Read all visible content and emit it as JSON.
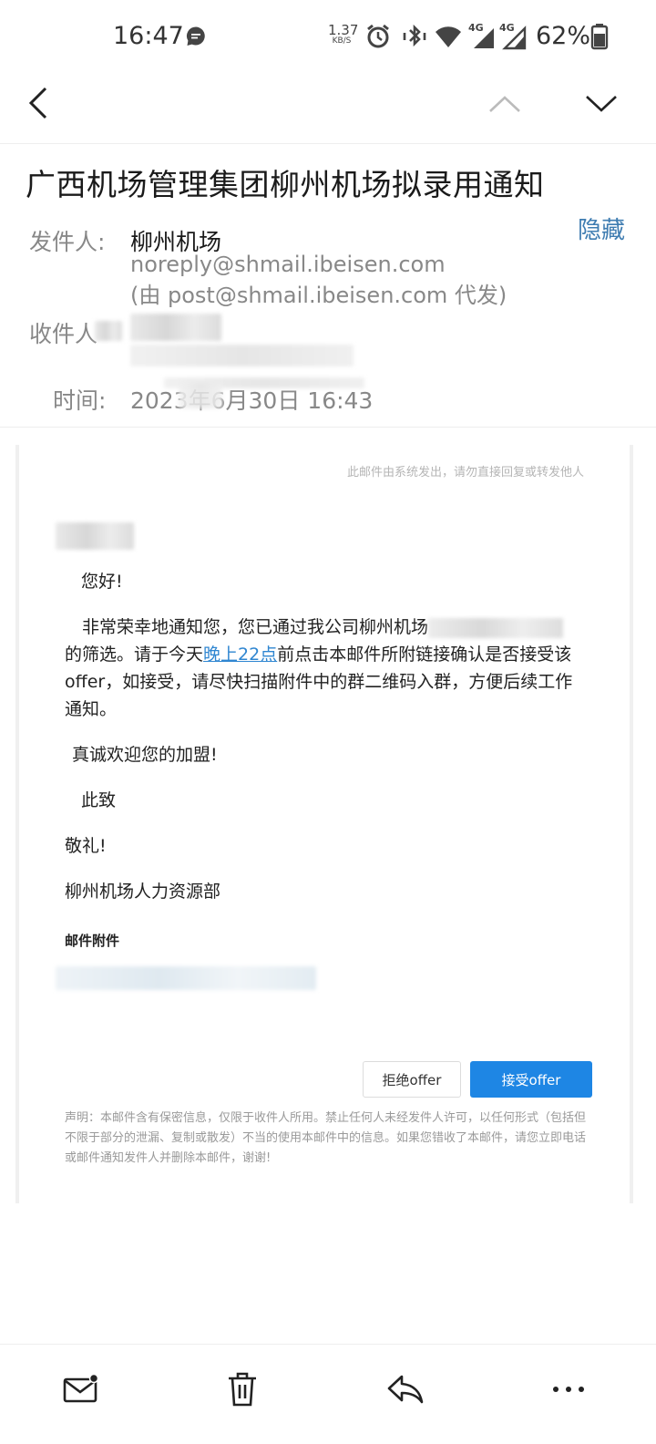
{
  "status_bar": {
    "time": "16:47",
    "net_speed": "1.37",
    "net_unit": "KB/S",
    "signal_1": "4G",
    "signal_2": "4G",
    "battery": "62%"
  },
  "subject": "广西机场管理集团柳州机场拟录用通知",
  "header": {
    "from_label": "发件人:",
    "from_name": "柳州机场",
    "from_email": "noreply@shmail.ibeisen.com",
    "from_via": "(由 post@shmail.ibeisen.com 代发)",
    "to_label": "收件人",
    "time_label": "时间:",
    "time_value": "2023年6月30日 16:43",
    "hide_label": "隐藏"
  },
  "mail": {
    "notice": "此邮件由系统发出，请勿直接回复或转发他人",
    "greeting": "您好!",
    "para_before": "非常荣幸地通知您，您已通过我公司柳州机场",
    "para_mid": "的筛选。请于今天",
    "link_text": "晚上22点",
    "para_after": "前点击本邮件所附链接确认是否接受该offer，如接受，请尽快扫描附件中的群二维码入群，方便后续工作通知。",
    "welcome": "真诚欢迎您的加盟!",
    "closing": "此致",
    "regards": "敬礼!",
    "signature": "柳州机场人力资源部",
    "attachments_title": "邮件附件",
    "reject_label": "拒绝offer",
    "accept_label": "接受offer",
    "disclaimer": "声明：本邮件含有保密信息，仅限于收件人所用。禁止任何人未经发件人许可，以任何形式（包括但不限于部分的泄漏、复制或散发）不当的使用本邮件中的信息。如果您错收了本邮件，请您立即电话或邮件通知发件人并删除本邮件，谢谢!",
    "accent_color": "#1e86e4"
  },
  "toolbar": {
    "icons": [
      "mail-icon",
      "trash-icon",
      "reply-icon",
      "more-icon"
    ]
  }
}
